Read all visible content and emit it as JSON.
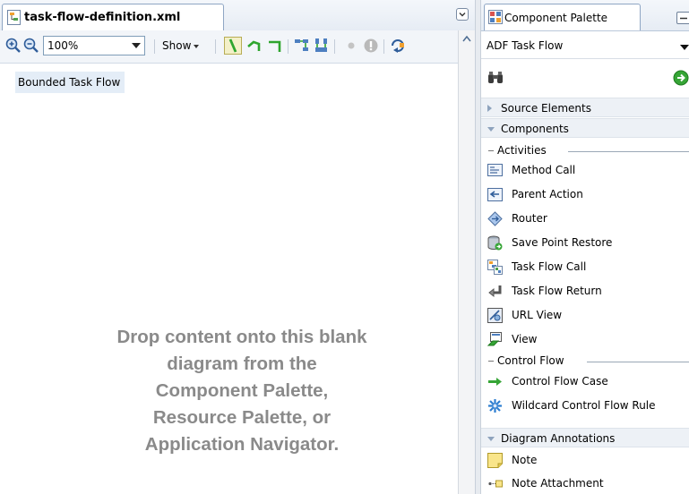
{
  "editor": {
    "tab_title": "task-flow-definition.xml",
    "zoom_value": "100%",
    "show_label": "Show",
    "flow_label": "Bounded Task Flow",
    "drop_hint": [
      "Drop content onto this blank",
      "diagram from the",
      "Component Palette,",
      "Resource Palette, or",
      "Application Navigator."
    ],
    "toolbar_icons": [
      "zoom-in-icon",
      "zoom-out-icon",
      "control-flow-case-icon",
      "wildcard-icon",
      "reroute-icon",
      "layout-horizontal-icon",
      "layout-vertical-icon",
      "dot-icon",
      "stop-icon",
      "refresh-icon"
    ]
  },
  "palette": {
    "tab_title": "Component Palette",
    "page_select": "ADF Task Flow",
    "sections": {
      "source_elements": "Source Elements",
      "components": "Components",
      "diagram_annotations": "Diagram Annotations"
    },
    "groups": {
      "activities": "Activities",
      "control_flow": "Control Flow"
    },
    "activities": [
      {
        "label": "Method Call",
        "icon": "method-call-icon"
      },
      {
        "label": "Parent Action",
        "icon": "parent-action-icon"
      },
      {
        "label": "Router",
        "icon": "router-icon"
      },
      {
        "label": "Save Point Restore",
        "icon": "save-point-restore-icon"
      },
      {
        "label": "Task Flow Call",
        "icon": "task-flow-call-icon"
      },
      {
        "label": "Task Flow Return",
        "icon": "task-flow-return-icon"
      },
      {
        "label": "URL View",
        "icon": "url-view-icon"
      },
      {
        "label": "View",
        "icon": "view-icon"
      }
    ],
    "control_flow": [
      {
        "label": "Control Flow Case",
        "icon": "control-flow-case-icon"
      },
      {
        "label": "Wildcard Control Flow Rule",
        "icon": "wildcard-rule-icon"
      }
    ],
    "annotations": [
      {
        "label": "Note",
        "icon": "note-icon"
      },
      {
        "label": "Note Attachment",
        "icon": "note-attachment-icon"
      }
    ]
  },
  "colors": {
    "accent_blue": "#5b84b5",
    "hint_gray": "#8a8a8a",
    "label_bg": "#e4edf7",
    "section_bg": "#edf1f6"
  }
}
